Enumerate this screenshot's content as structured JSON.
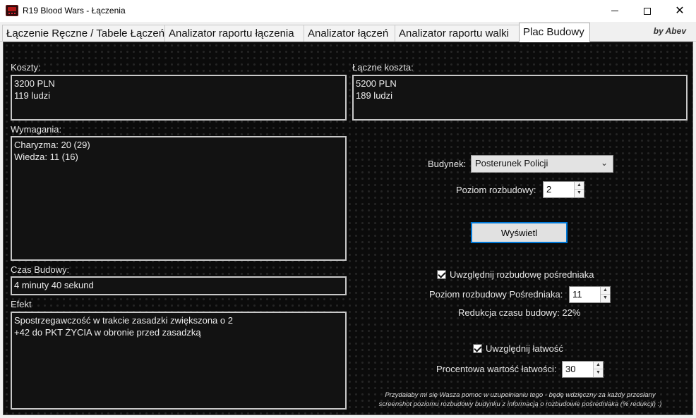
{
  "window": {
    "title": "R19 Blood Wars - Łączenia",
    "min_glyph": "",
    "close_glyph": "✕"
  },
  "tabs": [
    {
      "label": "Łączenie Ręczne / Tabele Łączeń"
    },
    {
      "label": "Analizator raportu łączenia"
    },
    {
      "label": "Analizator łączeń"
    },
    {
      "label": "Analizator raportu walki"
    },
    {
      "label": "Plac Budowy",
      "active": true
    }
  ],
  "byline": "by Abev",
  "costs": {
    "label": "Koszty:",
    "lines": [
      "3200 PLN",
      "119 ludzi"
    ]
  },
  "total_costs": {
    "label": "Łączne koszta:",
    "lines": [
      "5200 PLN",
      "189 ludzi"
    ]
  },
  "requirements": {
    "label": "Wymagania:",
    "lines": [
      "Charyzma: 20 (29)",
      "Wiedza: 11 (16)"
    ]
  },
  "build_time": {
    "label": "Czas Budowy:",
    "value": "4 minuty 40 sekund"
  },
  "effect": {
    "label": "Efekt",
    "lines": [
      "Spostrzegawczość w trakcie zasadzki zwiększona o 2",
      "+42 do PKT ŻYCIA w obronie przed zasadzką"
    ]
  },
  "form": {
    "building_label": "Budynek:",
    "building_value": "Posterunek Policji",
    "level_label": "Poziom rozbudowy:",
    "level_value": "2",
    "show_button": "Wyświetl",
    "include_broker_label": "Uwzględnij rozbudowę pośredniaka",
    "include_broker_checked": true,
    "broker_level_label": "Poziom rozbudowy Pośredniaka:",
    "broker_level_value": "11",
    "reduction_text": "Redukcja czasu budowy: 22%",
    "include_ease_label": "Uwzględnij łatwość",
    "include_ease_checked": true,
    "ease_label": "Procentowa wartość łatwości:",
    "ease_value": "30"
  },
  "footer_note": [
    "Przydałaby mi się Wasza pomoc w uzupełnianiu tego - będę wdzięczny za każdy przesłany",
    "screenshot poziomu rozbudowy budynku z informacją o rozbudowie pośredniaka (% redukcji) :)"
  ]
}
